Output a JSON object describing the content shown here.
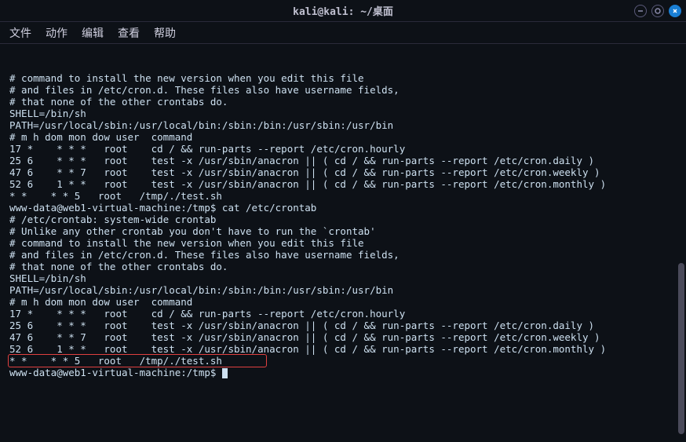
{
  "window": {
    "title": "kali@kali: ~/桌面"
  },
  "menu": {
    "file": "文件",
    "actions": "动作",
    "edit": "编辑",
    "view": "查看",
    "help": "帮助"
  },
  "terminal": {
    "lines": [
      "# command to install the new version when you edit this file",
      "# and files in /etc/cron.d. These files also have username fields,",
      "# that none of the other crontabs do.",
      "",
      "SHELL=/bin/sh",
      "PATH=/usr/local/sbin:/usr/local/bin:/sbin:/bin:/usr/sbin:/usr/bin",
      "",
      "# m h dom mon dow user  command",
      "17 *    * * *   root    cd / && run-parts --report /etc/cron.hourly",
      "25 6    * * *   root    test -x /usr/sbin/anacron || ( cd / && run-parts --report /etc/cron.daily )",
      "47 6    * * 7   root    test -x /usr/sbin/anacron || ( cd / && run-parts --report /etc/cron.weekly )",
      "52 6    1 * *   root    test -x /usr/sbin/anacron || ( cd / && run-parts --report /etc/cron.monthly )",
      "* *    * * 5   root   /tmp/./test.sh",
      "www-data@web1-virtual-machine:/tmp$ cat /etc/crontab",
      "# /etc/crontab: system-wide crontab",
      "# Unlike any other crontab you don't have to run the `crontab'",
      "# command to install the new version when you edit this file",
      "# and files in /etc/cron.d. These files also have username fields,",
      "# that none of the other crontabs do.",
      "",
      "SHELL=/bin/sh",
      "PATH=/usr/local/sbin:/usr/local/bin:/sbin:/bin:/usr/sbin:/usr/bin",
      "",
      "# m h dom mon dow user  command",
      "17 *    * * *   root    cd / && run-parts --report /etc/cron.hourly",
      "25 6    * * *   root    test -x /usr/sbin/anacron || ( cd / && run-parts --report /etc/cron.daily )",
      "47 6    * * 7   root    test -x /usr/sbin/anacron || ( cd / && run-parts --report /etc/cron.weekly )",
      "52 6    1 * *   root    test -x /usr/sbin/anacron || ( cd / && run-parts --report /etc/cron.monthly )",
      "* *    * * 5   root   /tmp/./test.sh",
      "www-data@web1-virtual-machine:/tmp$ "
    ],
    "highlight_line_index": 28,
    "highlight_text": "* *    * * 5   root   /tmp/./test.sh"
  }
}
